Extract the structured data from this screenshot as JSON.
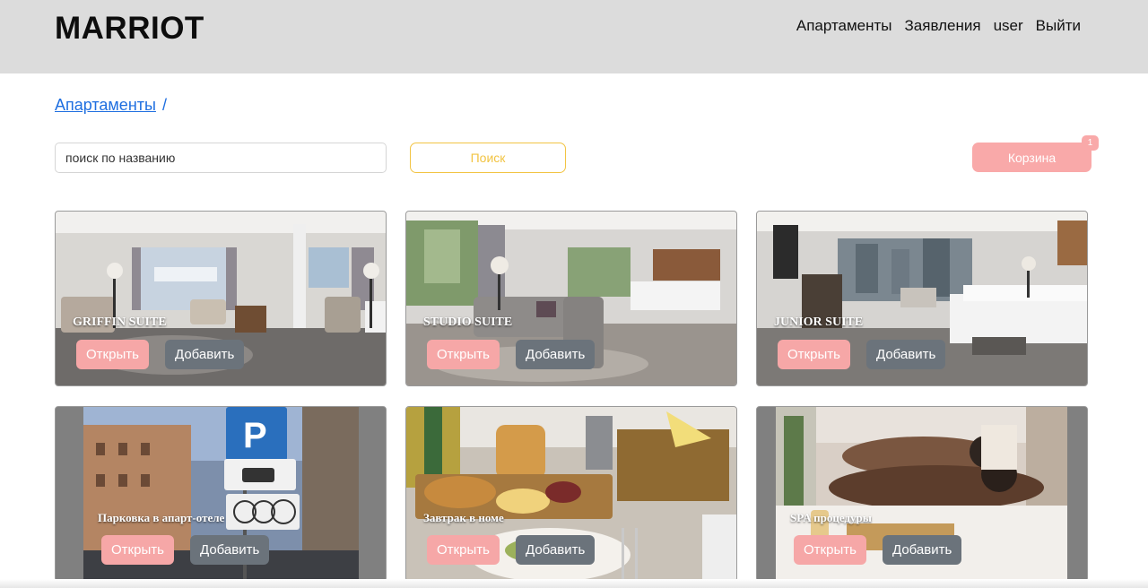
{
  "header": {
    "brand": "MARRIOT",
    "nav": [
      "Апартаменты",
      "Заявления",
      "user",
      "Выйти"
    ]
  },
  "breadcrumb": {
    "link": "Апартаменты",
    "separator": "/"
  },
  "search": {
    "placeholder": "поиск по названию",
    "value": "",
    "button_label": "Поиск"
  },
  "cart": {
    "label": "Корзина",
    "count": "1"
  },
  "cards": [
    {
      "title": "GRIFFIN SUITE",
      "open_label": "Открыть",
      "add_label": "Добавить"
    },
    {
      "title": "STUDIO SUITE",
      "open_label": "Открыть",
      "add_label": "Добавить"
    },
    {
      "title": "JUNIOR SUITE",
      "open_label": "Открыть",
      "add_label": "Добавить"
    },
    {
      "title": "Парковка в апарт-отеле",
      "open_label": "Открыть",
      "add_label": "Добавить"
    },
    {
      "title": "Завтрак в номе",
      "open_label": "Открыть",
      "add_label": "Добавить"
    },
    {
      "title": "SPA процедуры",
      "open_label": "Открыть",
      "add_label": "Добавить"
    }
  ],
  "colors": {
    "header_bg": "#dcdcdc",
    "link": "#1f6fe0",
    "search_accent": "#f2c443",
    "cart": "#f9a9a9",
    "open_button": "#f6a7a7",
    "add_button": "#6b737b"
  }
}
